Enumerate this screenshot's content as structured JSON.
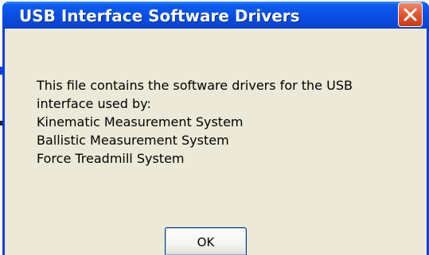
{
  "dialog": {
    "title": "USB Interface Software Drivers",
    "message_lines": [
      "This file contains the software drivers for the USB",
      "interface used by:",
      "Kinematic Measurement System",
      "Ballistic Measurement System",
      "Force Treadmill System"
    ],
    "ok_label": "OK"
  },
  "colors": {
    "titlebar": "#0a4fe3",
    "client_bg": "#ece9d8",
    "close_button": "#e05a34"
  },
  "icons": {
    "close": "close-icon"
  }
}
